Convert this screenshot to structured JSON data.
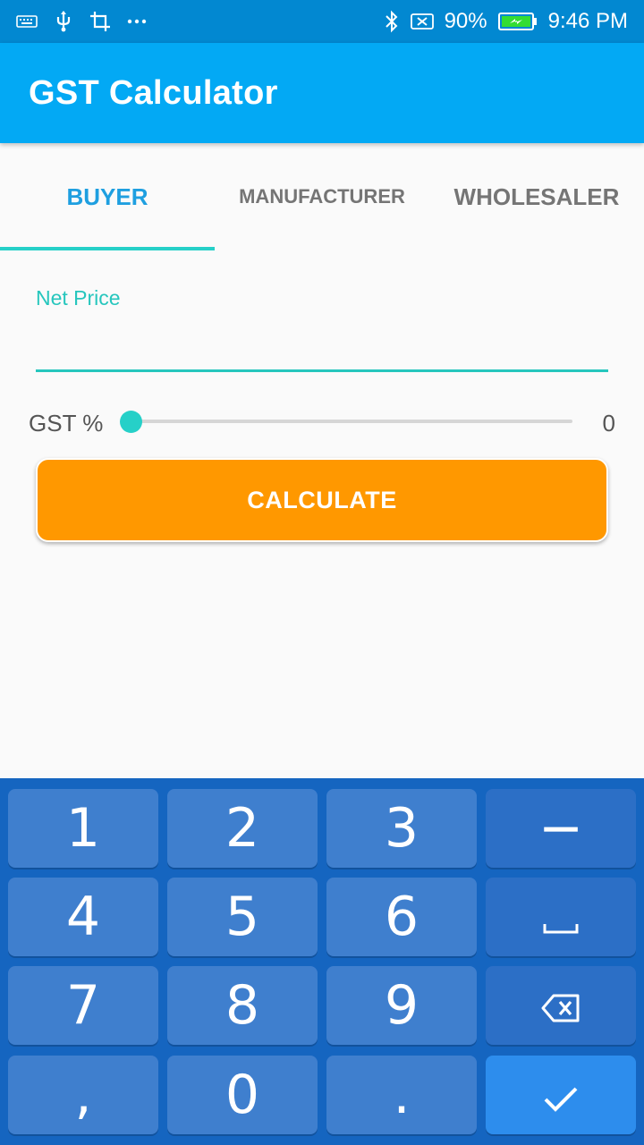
{
  "status_bar": {
    "battery_percent": "90%",
    "time": "9:46 PM",
    "left_icons": [
      "keyboard-icon",
      "usb-icon",
      "crop-icon",
      "more-icon"
    ],
    "right_icons": [
      "bluetooth-icon",
      "no-sim-icon",
      "battery-charging-icon"
    ]
  },
  "app_bar": {
    "title": "GST Calculator"
  },
  "tabs": [
    {
      "label": "BUYER",
      "active": true
    },
    {
      "label": "MANUFACTURER",
      "active": false
    },
    {
      "label": "WHOLESALER",
      "active": false
    }
  ],
  "net_price": {
    "label": "Net Price",
    "value": ""
  },
  "gst": {
    "label": "GST %",
    "value": "0",
    "slider_fraction": 0
  },
  "calculate_button": {
    "label": "CALCULATE"
  },
  "keyboard": {
    "keys": [
      "1",
      "2",
      "3",
      "−",
      "4",
      "5",
      "6",
      "space",
      "7",
      "8",
      "9",
      "backspace",
      ",",
      "0",
      ".",
      "done"
    ]
  },
  "colors": {
    "status_bar": "#0288d1",
    "app_bar": "#03a9f4",
    "accent": "#26d0c8",
    "active_tab": "#1e9fe0",
    "calculate_button": "#ff9800",
    "keyboard_bg": "#1565c0",
    "key_bg": "#3f7fce",
    "done_key": "#2d8ded"
  }
}
